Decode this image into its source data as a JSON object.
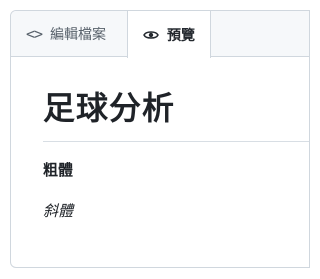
{
  "tabs": {
    "edit": {
      "label": "編輯檔案",
      "icon": "code-icon"
    },
    "preview": {
      "label": "預覽",
      "icon": "eye-icon",
      "selected": true
    }
  },
  "document": {
    "heading": "足球分析",
    "bold_text": "粗體",
    "italic_text": "斜體"
  },
  "colors": {
    "border": "#d0d7de",
    "tab_bar_bg": "#f6f8fa",
    "text": "#1f2328",
    "muted_text": "#57606a"
  }
}
